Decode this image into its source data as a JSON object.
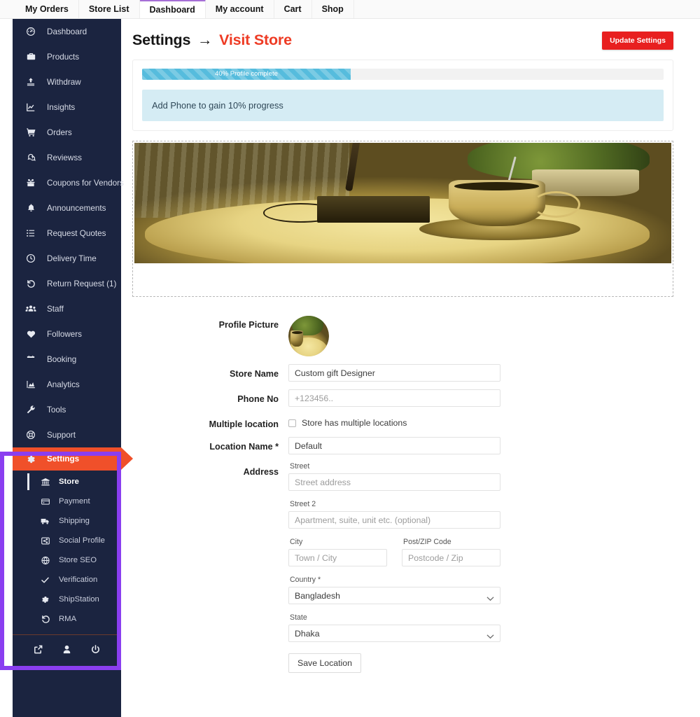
{
  "topnav": {
    "items": [
      {
        "label": "My Orders",
        "active": false
      },
      {
        "label": "Store List",
        "active": false
      },
      {
        "label": "Dashboard",
        "active": true
      },
      {
        "label": "My account",
        "active": false
      },
      {
        "label": "Cart",
        "active": false
      },
      {
        "label": "Shop",
        "active": false
      }
    ],
    "active_underline_color": "#a66fd6"
  },
  "sidebar": {
    "background": "#1b2440",
    "active_color": "#f0502a",
    "items": [
      {
        "label": "Dashboard",
        "icon": "speedometer-icon"
      },
      {
        "label": "Products",
        "icon": "briefcase-icon"
      },
      {
        "label": "Withdraw",
        "icon": "upload-box-icon"
      },
      {
        "label": "Insights",
        "icon": "chart-line-icon"
      },
      {
        "label": "Orders",
        "icon": "shopping-cart-icon"
      },
      {
        "label": "Reviewss",
        "icon": "comments-icon"
      },
      {
        "label": "Coupons for Vendors",
        "icon": "gift-icon"
      },
      {
        "label": "Announcements",
        "icon": "bell-icon"
      },
      {
        "label": "Request Quotes",
        "icon": "list-icon"
      },
      {
        "label": "Delivery Time",
        "icon": "clock-icon"
      },
      {
        "label": "Return Request (1)",
        "icon": "undo-icon"
      },
      {
        "label": "Staff",
        "icon": "users-icon"
      },
      {
        "label": "Followers",
        "icon": "heart-icon"
      },
      {
        "label": "Booking",
        "icon": "calendar-icon"
      },
      {
        "label": "Analytics",
        "icon": "chart-area-icon"
      },
      {
        "label": "Tools",
        "icon": "wrench-icon"
      },
      {
        "label": "Support",
        "icon": "lifebuoy-icon"
      }
    ],
    "settings": {
      "label": "Settings",
      "icon": "gear-icon"
    },
    "subitems": [
      {
        "label": "Store",
        "icon": "bank-icon",
        "current": true
      },
      {
        "label": "Payment",
        "icon": "credit-card-icon",
        "current": false
      },
      {
        "label": "Shipping",
        "icon": "truck-icon",
        "current": false
      },
      {
        "label": "Social Profile",
        "icon": "share-icon",
        "current": false
      },
      {
        "label": "Store SEO",
        "icon": "globe-icon",
        "current": false
      },
      {
        "label": "Verification",
        "icon": "check-icon",
        "current": false
      },
      {
        "label": "ShipStation",
        "icon": "gear-icon",
        "current": false
      },
      {
        "label": "RMA",
        "icon": "undo-icon",
        "current": false
      }
    ],
    "footer_icons": [
      "external-link-icon",
      "user-icon",
      "power-icon"
    ],
    "highlight_box_color": "#8a3ef0"
  },
  "header": {
    "title": "Settings",
    "arrow": "→",
    "link": "Visit Store",
    "link_color": "#ee3b24",
    "update_button": "Update Settings",
    "update_button_color": "#e81f1f"
  },
  "progress": {
    "percent": 40,
    "bar_label": "40% Profile complete",
    "bar_color": "#56bcdd",
    "note": "Add Phone to gain 10% progress",
    "note_bg": "#d5ecf4"
  },
  "banner": {
    "alt": "store-banner-teacup-on-table"
  },
  "form": {
    "profile_picture_label": "Profile Picture",
    "store_name_label": "Store Name",
    "store_name_value": "Custom gift Designer",
    "phone_label": "Phone No",
    "phone_placeholder": "+123456..",
    "phone_value": "",
    "multiple_location_label": "Multiple location",
    "multiple_location_checkbox_label": "Store has multiple locations",
    "multiple_location_checked": false,
    "location_name_label": "Location Name *",
    "location_name_value": "Default",
    "address_label": "Address",
    "street_label": "Street",
    "street_placeholder": "Street address",
    "street_value": "",
    "street2_label": "Street 2",
    "street2_placeholder": "Apartment, suite, unit etc. (optional)",
    "street2_value": "",
    "city_label": "City",
    "city_placeholder": "Town / City",
    "city_value": "",
    "postcode_label": "Post/ZIP Code",
    "postcode_placeholder": "Postcode / Zip",
    "postcode_value": "",
    "country_label": "Country *",
    "country_value": "Bangladesh",
    "state_label": "State",
    "state_value": "Dhaka",
    "save_button": "Save Location"
  }
}
